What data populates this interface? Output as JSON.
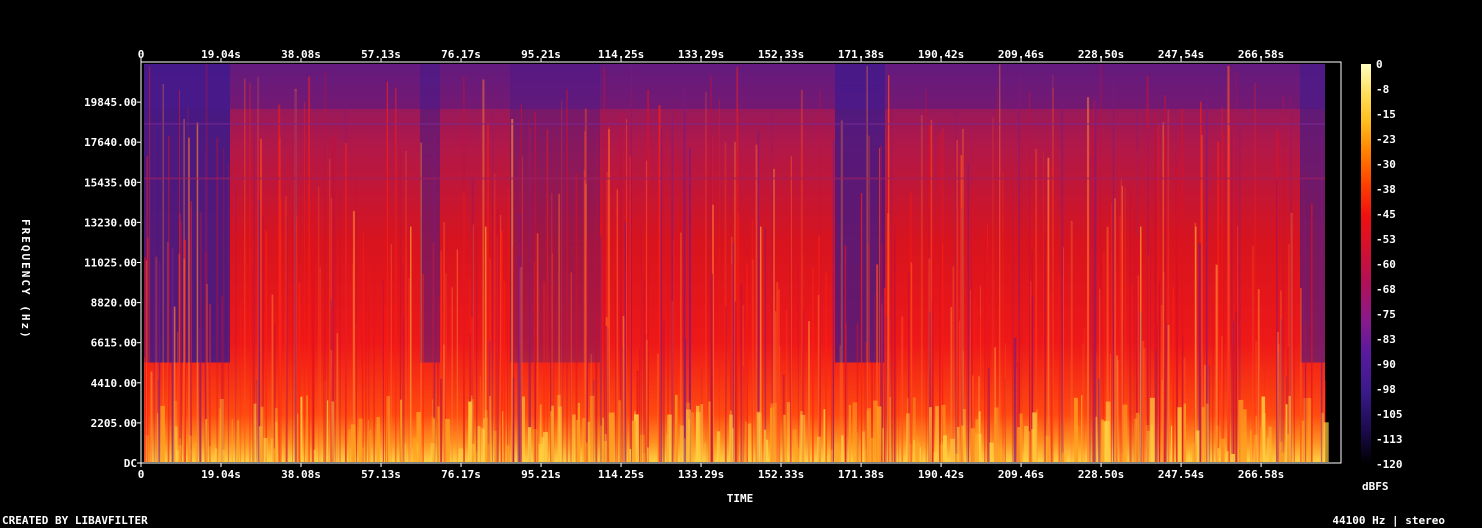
{
  "chart_data": {
    "type": "heatmap",
    "title": "",
    "xlabel": "TIME",
    "ylabel": "FREQUENCY (Hz)",
    "x_ticks_top": [
      "0",
      "19.04s",
      "38.08s",
      "57.13s",
      "76.17s",
      "95.21s",
      "114.25s",
      "133.29s",
      "152.33s",
      "171.38s",
      "190.42s",
      "209.46s",
      "228.50s",
      "247.54s",
      "266.58s"
    ],
    "x_ticks_bottom": [
      "0",
      "19.04s",
      "38.08s",
      "57.13s",
      "76.17s",
      "95.21s",
      "114.25s",
      "133.29s",
      "152.33s",
      "171.38s",
      "190.42s",
      "209.46s",
      "228.50s",
      "247.54s",
      "266.58s"
    ],
    "x_tick_seconds": [
      0,
      19.04,
      38.08,
      57.13,
      76.17,
      95.21,
      114.25,
      133.29,
      152.33,
      171.38,
      190.42,
      209.46,
      228.5,
      247.54,
      266.58
    ],
    "y_ticks": [
      "DC",
      "2205.00",
      "4410.00",
      "6615.00",
      "8820.00",
      "11025.00",
      "13230.00",
      "15435.00",
      "17640.00",
      "19845.00"
    ],
    "y_tick_hz": [
      0,
      2205,
      4410,
      6615,
      8820,
      11025,
      13230,
      15435,
      17640,
      19845
    ],
    "xlim": [
      0,
      285.6
    ],
    "ylim": [
      0,
      22050
    ],
    "colorbar": {
      "label": "dBFS",
      "ticks": [
        "0",
        "-8",
        "-15",
        "-23",
        "-30",
        "-38",
        "-45",
        "-53",
        "-60",
        "-68",
        "-75",
        "-83",
        "-90",
        "-98",
        "-105",
        "-113",
        "-120"
      ],
      "range": [
        -120,
        0
      ],
      "colormap": [
        "#000000",
        "#1a0a4a",
        "#3a1a8a",
        "#5a1aa0",
        "#8a1a8a",
        "#b0105a",
        "#d8102a",
        "#f01010",
        "#ff4000",
        "#ff8000",
        "#ffc020",
        "#ffe060",
        "#ffffc0"
      ]
    },
    "footer_left": "CREATED BY LIBAVFILTER",
    "footer_right": "44100 Hz | stereo"
  }
}
